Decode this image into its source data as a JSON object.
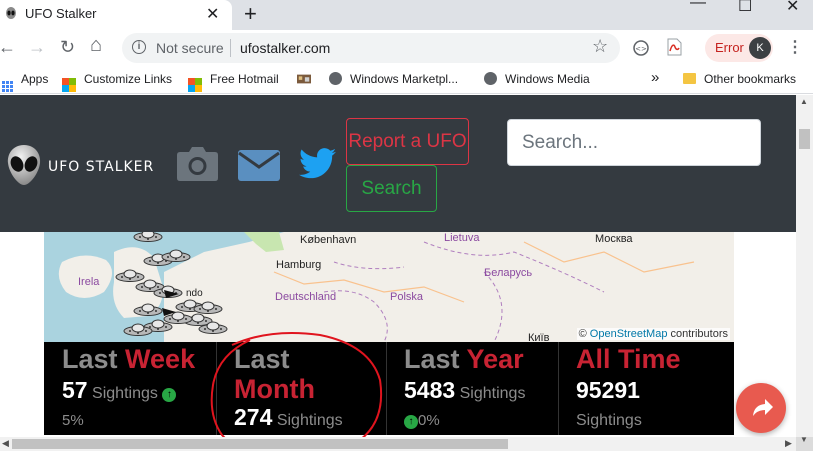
{
  "browser": {
    "tab_title": "UFO Stalker",
    "tab_close": "✕",
    "new_tab": "+",
    "window_min": "—",
    "window_max": "☐",
    "window_close": "✕",
    "nav": {
      "back": "←",
      "forward": "→",
      "reload": "↻",
      "home": "⌂"
    },
    "omnibox": {
      "info": "i",
      "security": "Not secure",
      "url": "ufostalker.com",
      "star": "☆"
    },
    "error_label": "Error",
    "profile_initial": "K",
    "menu": "⋮",
    "bookmarks": [
      {
        "label": "Apps",
        "icon": "apps-icon"
      },
      {
        "label": "Customize Links",
        "icon": "windows-icon"
      },
      {
        "label": "Free Hotmail",
        "icon": "windows-icon"
      },
      {
        "label": "",
        "icon": "bookmark-favicon"
      },
      {
        "label": "Windows Marketpl...",
        "icon": "globe-icon"
      },
      {
        "label": "Windows Media",
        "icon": "globe-icon"
      }
    ],
    "bookmarks_overflow": "»",
    "other_bookmarks": "Other bookmarks"
  },
  "site": {
    "logo_text": "UFO STALKER",
    "report_button": "Report a UFO",
    "search_placeholder": "Search...",
    "search_button": "Search",
    "colors": {
      "header_bg": "#343a40",
      "danger": "#dc3545",
      "success": "#28a745",
      "twitter": "#1da1f2",
      "icon_grey": "#6c757d",
      "fab": "#e85a4f"
    }
  },
  "map": {
    "labels": {
      "kobenhavn": "København",
      "lietuva": "Lietuva",
      "moskva": "Москва",
      "hamburg": "Hamburg",
      "ireland": "Irela",
      "belarus": "Беларусь",
      "deutschland": "Deutschland",
      "polska": "Polska",
      "kyiv": "Київ"
    },
    "attribution_prefix": "©",
    "attribution_link": "OpenStreetMap",
    "attribution_suffix": "contributors"
  },
  "stats": [
    {
      "title_a": "Last",
      "title_b": "Week",
      "count": "57",
      "unit": "Sightings",
      "change": "5%",
      "arrow": "↑"
    },
    {
      "title_a": "Last",
      "title_b": "Month",
      "count": "274",
      "unit": "Sightings"
    },
    {
      "title_a": "Last",
      "title_b": "Year",
      "count": "5483",
      "unit": "Sightings",
      "change": "0%",
      "arrow": "↑"
    },
    {
      "title": "All Time",
      "count": "95291",
      "unit": "Sightings"
    }
  ],
  "scroll": {
    "up": "▲",
    "down": "▼",
    "left": "◀",
    "right": "▶"
  }
}
